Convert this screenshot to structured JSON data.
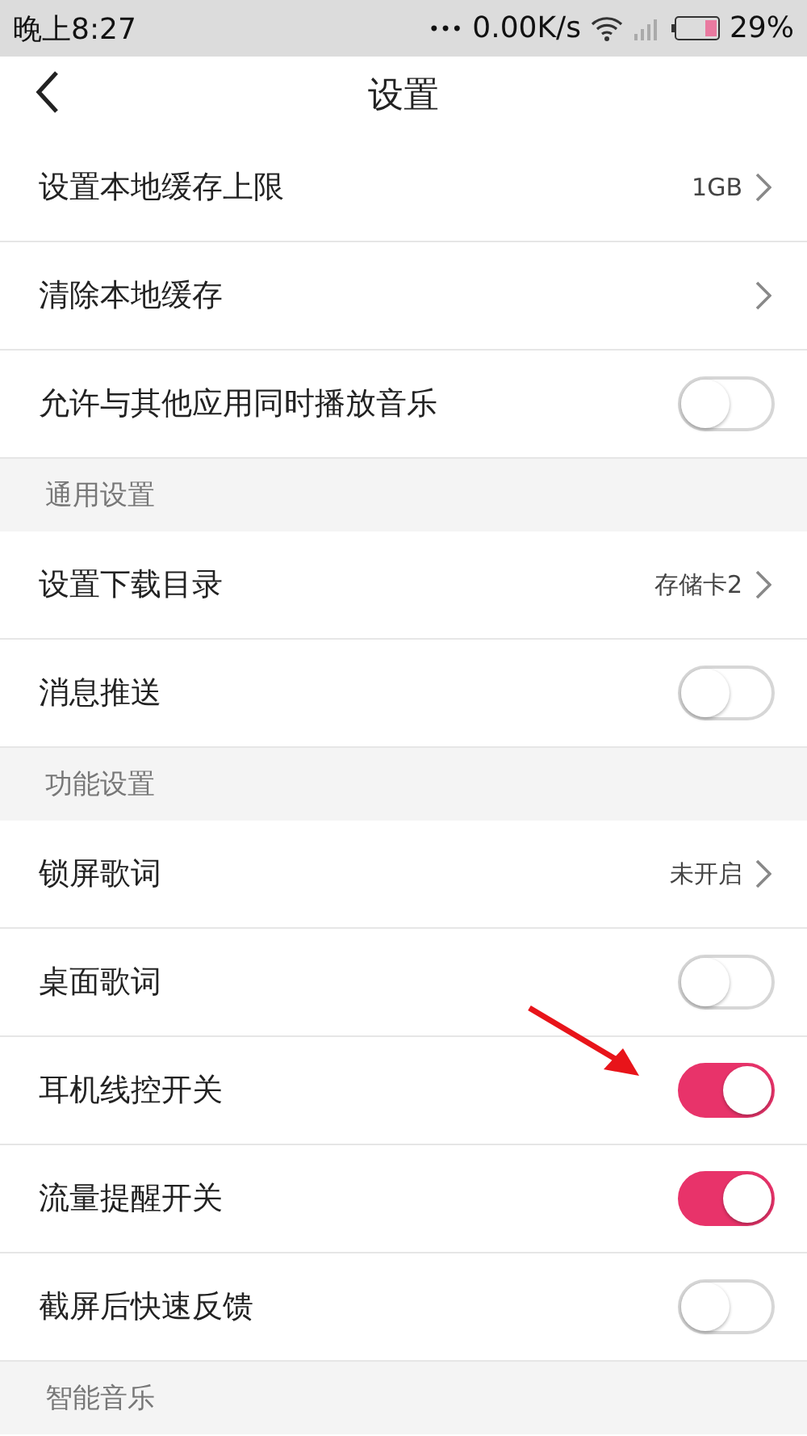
{
  "status_bar": {
    "time": "晚上8:27",
    "dots": "•••",
    "speed": "0.00K/s",
    "battery": "29%"
  },
  "header": {
    "title": "设置"
  },
  "sections": [
    {
      "items": [
        {
          "kind": "link",
          "label": "设置本地缓存上限",
          "value": "1GB"
        },
        {
          "kind": "link",
          "label": "清除本地缓存"
        },
        {
          "kind": "toggle",
          "label": "允许与其他应用同时播放音乐",
          "on": false
        }
      ]
    },
    {
      "title": "通用设置",
      "items": [
        {
          "kind": "link",
          "label": "设置下载目录",
          "value": "存储卡2"
        },
        {
          "kind": "toggle",
          "label": "消息推送",
          "on": false
        }
      ]
    },
    {
      "title": "功能设置",
      "items": [
        {
          "kind": "link",
          "label": "锁屏歌词",
          "value": "未开启"
        },
        {
          "kind": "toggle",
          "label": "桌面歌词",
          "on": false
        },
        {
          "kind": "toggle",
          "label": "耳机线控开关",
          "on": true,
          "annotated": true
        },
        {
          "kind": "toggle",
          "label": "流量提醒开关",
          "on": true
        },
        {
          "kind": "toggle",
          "label": "截屏后快速反馈",
          "on": false
        }
      ]
    },
    {
      "title": "智能音乐"
    }
  ]
}
